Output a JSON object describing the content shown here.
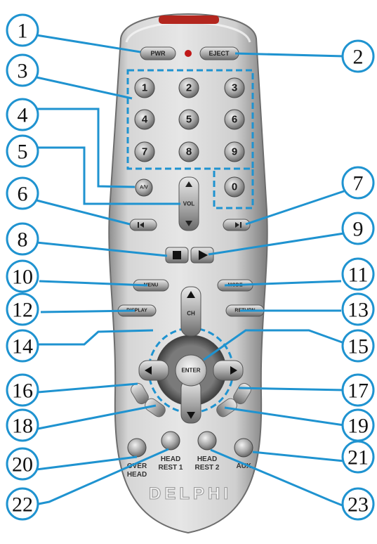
{
  "remote": {
    "buttons": {
      "pwr": "PWR",
      "eject": "EJECT",
      "keypad": [
        "1",
        "2",
        "3",
        "4",
        "5",
        "6",
        "7",
        "8",
        "9",
        "0"
      ],
      "aux_a": "A/V",
      "vol": "VOL",
      "prev": "",
      "next": "",
      "stop": "",
      "play": "",
      "menu": "MENU",
      "mode": "MODE",
      "display": "DISPLAY",
      "return": "RETURN",
      "ch": "CH",
      "enter": "ENTER",
      "overhead": [
        "OVER",
        "HEAD"
      ],
      "headrest1": [
        "HEAD",
        "REST 1"
      ],
      "headrest2": [
        "HEAD",
        "REST 2"
      ],
      "aux": "AUX"
    },
    "brand": "DELPHI"
  },
  "callouts": [
    "1",
    "2",
    "3",
    "4",
    "5",
    "6",
    "7",
    "8",
    "9",
    "10",
    "11",
    "12",
    "13",
    "14",
    "15",
    "16",
    "17",
    "18",
    "19",
    "20",
    "21",
    "22",
    "23"
  ],
  "colors": {
    "callout_line": "#1f93d0",
    "body": "#c9c9c9",
    "button": "#8c8c8c",
    "led": "#c01818",
    "ir_window": "#b3261e"
  }
}
